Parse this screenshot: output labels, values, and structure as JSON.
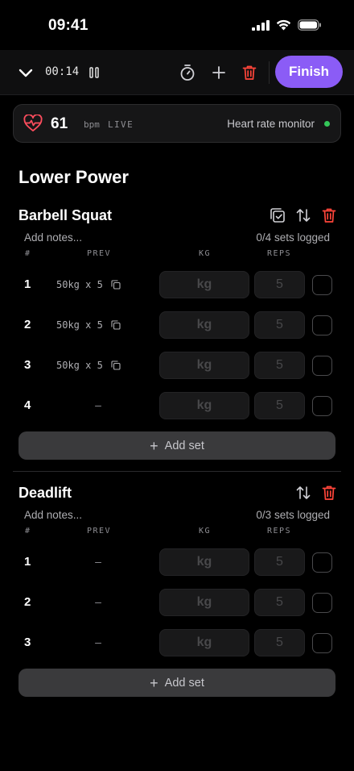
{
  "status_bar": {
    "time": "09:41"
  },
  "toolbar": {
    "elapsed": "00:14",
    "finish_label": "Finish"
  },
  "heart_rate": {
    "value": "61",
    "unit": "bpm",
    "live_label": "LIVE",
    "monitor_label": "Heart rate monitor"
  },
  "workout": {
    "title": "Lower Power"
  },
  "columns": {
    "set": "#",
    "prev": "PREV",
    "kg": "KG",
    "reps": "REPS"
  },
  "exercises": [
    {
      "name": "Barbell Squat",
      "notes_placeholder": "Add notes...",
      "logged": "0/4 sets logged",
      "add_set_label": "Add set",
      "sets": [
        {
          "num": "1",
          "prev": "50kg x 5",
          "kg_placeholder": "kg",
          "reps_placeholder": "5"
        },
        {
          "num": "2",
          "prev": "50kg x 5",
          "kg_placeholder": "kg",
          "reps_placeholder": "5"
        },
        {
          "num": "3",
          "prev": "50kg x 5",
          "kg_placeholder": "kg",
          "reps_placeholder": "5"
        },
        {
          "num": "4",
          "prev": "–",
          "kg_placeholder": "kg",
          "reps_placeholder": "5"
        }
      ]
    },
    {
      "name": "Deadlift",
      "notes_placeholder": "Add notes...",
      "logged": "0/3 sets logged",
      "add_set_label": "Add set",
      "sets": [
        {
          "num": "1",
          "prev": "–",
          "kg_placeholder": "kg",
          "reps_placeholder": "5"
        },
        {
          "num": "2",
          "prev": "–",
          "kg_placeholder": "kg",
          "reps_placeholder": "5"
        },
        {
          "num": "3",
          "prev": "–",
          "kg_placeholder": "kg",
          "reps_placeholder": "5"
        }
      ]
    }
  ],
  "colors": {
    "accent": "#8b5cf6",
    "danger": "#ff453a",
    "live": "#34c759"
  }
}
